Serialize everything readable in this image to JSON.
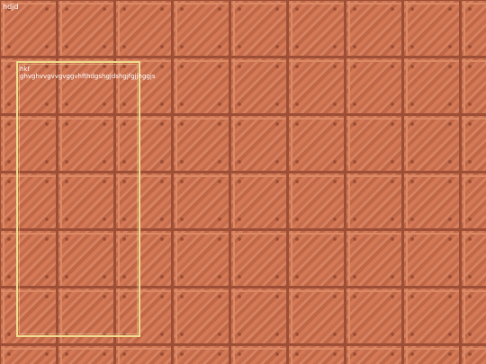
{
  "hud": {
    "corner_label": "hdjd"
  },
  "dialog": {
    "title": "hkf",
    "body": "ghvghvvgvvgvggvhfthdgshgjdshgjfgjjhggjs"
  },
  "background": {
    "tile": "riveted-copper-plate",
    "base_color": "#c8704f",
    "frame_color": "#efdc8d"
  }
}
